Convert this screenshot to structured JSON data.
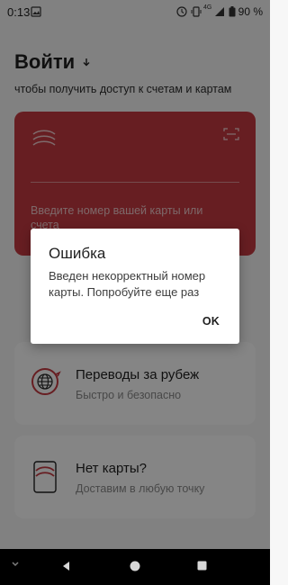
{
  "status_bar": {
    "time": "0:13",
    "battery": "90 %",
    "network": "4G"
  },
  "header": {
    "title": "Войти",
    "subtitle": "чтобы получить доступ к счетам и картам"
  },
  "card_input": {
    "placeholder": "Введите номер вашей карты или счета"
  },
  "tiles": [
    {
      "title": "Переводы за рубеж",
      "subtitle": "Быстро и безопасно"
    },
    {
      "title": "Нет карты?",
      "subtitle": "Доставим в любую точку"
    }
  ],
  "dialog": {
    "title": "Ошибка",
    "message": "Введен некорректный номер карты. Попробуйте еще раз",
    "ok_label": "OK"
  },
  "colors": {
    "card_red": "#c63a41",
    "background": "#f7f7f7",
    "overlay": "rgba(0,0,0,0.48)"
  }
}
